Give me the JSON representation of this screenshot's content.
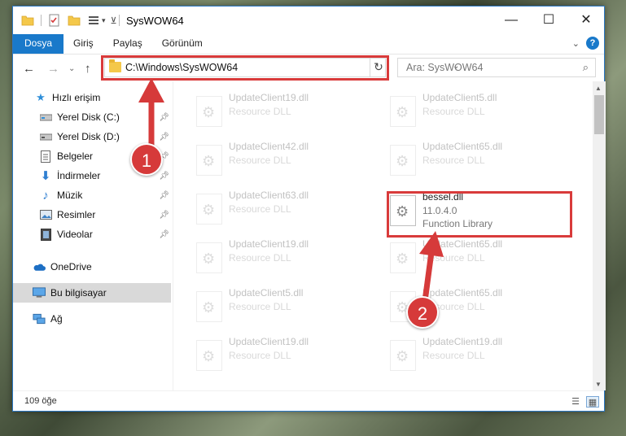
{
  "window": {
    "title": "SysWOW64",
    "controls": {
      "minimize": "—",
      "maximize": "☐",
      "close": "✕"
    }
  },
  "ribbon": {
    "tabs": [
      "Dosya",
      "Giriş",
      "Paylaş",
      "Görünüm"
    ],
    "active_tab": "Dosya",
    "expand_icon": "chevron-down-icon",
    "help_label": "?"
  },
  "address_bar": {
    "path": "C:\\Windows\\SysWOW64",
    "refresh_icon": "↻",
    "dropdown_icon": "⌄"
  },
  "search": {
    "placeholder": "Ara: SysWOW64",
    "icon": "⌕"
  },
  "nav_buttons": {
    "back": "←",
    "forward": "→",
    "recent": "⌄",
    "up": "↑"
  },
  "sidebar": {
    "quick_access": {
      "label": "Hızlı erişim",
      "icon": "star-icon"
    },
    "items": [
      {
        "label": "Yerel Disk (C:)",
        "icon": "drive-icon",
        "pinned": true
      },
      {
        "label": "Yerel Disk (D:)",
        "icon": "drive-icon",
        "pinned": true
      },
      {
        "label": "Belgeler",
        "icon": "documents-icon",
        "pinned": true
      },
      {
        "label": "İndirmeler",
        "icon": "downloads-icon",
        "pinned": true
      },
      {
        "label": "Müzik",
        "icon": "music-icon",
        "pinned": true
      },
      {
        "label": "Resimler",
        "icon": "pictures-icon",
        "pinned": true
      },
      {
        "label": "Videolar",
        "icon": "videos-icon",
        "pinned": true
      }
    ],
    "onedrive": {
      "label": "OneDrive",
      "icon": "cloud-icon"
    },
    "this_pc": {
      "label": "Bu bilgisayar",
      "icon": "computer-icon",
      "selected": true
    },
    "network": {
      "label": "Ağ",
      "icon": "network-icon"
    }
  },
  "files": {
    "left_column": [
      {
        "name": "UpdateClient19.dll",
        "type": "Resource DLL"
      },
      {
        "name": "UpdateClient42.dll",
        "type": "Resource DLL"
      },
      {
        "name": "UpdateClient63.dll",
        "type": "Resource DLL"
      },
      {
        "name": "UpdateClient19.dll",
        "type": "Resource DLL"
      },
      {
        "name": "UpdateClient5.dll",
        "type": "Resource DLL"
      },
      {
        "name": "UpdateClient19.dll",
        "type": "Resource DLL"
      }
    ],
    "right_column": [
      {
        "name": "UpdateClient5.dll",
        "type": "Resource DLL"
      },
      {
        "name": "UpdateClient65.dll",
        "type": "Resource DLL"
      },
      {
        "name": "bessel.dll",
        "version": "11.0.4.0",
        "type": "Function Library",
        "highlighted": true
      },
      {
        "name": "UpdateClient65.dll",
        "type": "Resource DLL"
      },
      {
        "name": "UpdateClient65.dll",
        "type": "Resource DLL"
      },
      {
        "name": "UpdateClient19.dll",
        "type": "Resource DLL"
      }
    ]
  },
  "status_bar": {
    "item_count": "109 öğe"
  },
  "annotations": [
    {
      "number": "1",
      "color": "#d63a3a"
    },
    {
      "number": "2",
      "color": "#d63a3a"
    }
  ]
}
